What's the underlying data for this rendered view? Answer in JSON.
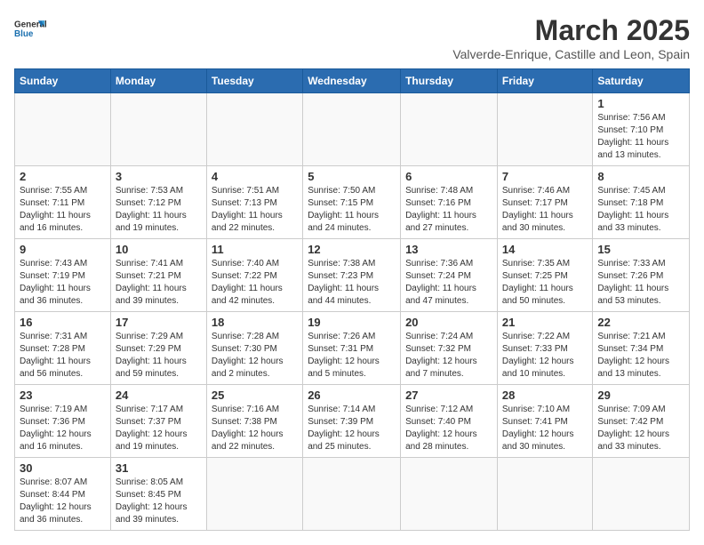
{
  "logo": {
    "text_general": "General",
    "text_blue": "Blue"
  },
  "title": "March 2025",
  "subtitle": "Valverde-Enrique, Castille and Leon, Spain",
  "days_of_week": [
    "Sunday",
    "Monday",
    "Tuesday",
    "Wednesday",
    "Thursday",
    "Friday",
    "Saturday"
  ],
  "weeks": [
    [
      {
        "day": "",
        "info": ""
      },
      {
        "day": "",
        "info": ""
      },
      {
        "day": "",
        "info": ""
      },
      {
        "day": "",
        "info": ""
      },
      {
        "day": "",
        "info": ""
      },
      {
        "day": "",
        "info": ""
      },
      {
        "day": "1",
        "info": "Sunrise: 7:56 AM\nSunset: 7:10 PM\nDaylight: 11 hours and 13 minutes."
      }
    ],
    [
      {
        "day": "2",
        "info": "Sunrise: 7:55 AM\nSunset: 7:11 PM\nDaylight: 11 hours and 16 minutes."
      },
      {
        "day": "3",
        "info": "Sunrise: 7:53 AM\nSunset: 7:12 PM\nDaylight: 11 hours and 19 minutes."
      },
      {
        "day": "4",
        "info": "Sunrise: 7:51 AM\nSunset: 7:13 PM\nDaylight: 11 hours and 22 minutes."
      },
      {
        "day": "5",
        "info": "Sunrise: 7:50 AM\nSunset: 7:15 PM\nDaylight: 11 hours and 24 minutes."
      },
      {
        "day": "6",
        "info": "Sunrise: 7:48 AM\nSunset: 7:16 PM\nDaylight: 11 hours and 27 minutes."
      },
      {
        "day": "7",
        "info": "Sunrise: 7:46 AM\nSunset: 7:17 PM\nDaylight: 11 hours and 30 minutes."
      },
      {
        "day": "8",
        "info": "Sunrise: 7:45 AM\nSunset: 7:18 PM\nDaylight: 11 hours and 33 minutes."
      }
    ],
    [
      {
        "day": "9",
        "info": "Sunrise: 7:43 AM\nSunset: 7:19 PM\nDaylight: 11 hours and 36 minutes."
      },
      {
        "day": "10",
        "info": "Sunrise: 7:41 AM\nSunset: 7:21 PM\nDaylight: 11 hours and 39 minutes."
      },
      {
        "day": "11",
        "info": "Sunrise: 7:40 AM\nSunset: 7:22 PM\nDaylight: 11 hours and 42 minutes."
      },
      {
        "day": "12",
        "info": "Sunrise: 7:38 AM\nSunset: 7:23 PM\nDaylight: 11 hours and 44 minutes."
      },
      {
        "day": "13",
        "info": "Sunrise: 7:36 AM\nSunset: 7:24 PM\nDaylight: 11 hours and 47 minutes."
      },
      {
        "day": "14",
        "info": "Sunrise: 7:35 AM\nSunset: 7:25 PM\nDaylight: 11 hours and 50 minutes."
      },
      {
        "day": "15",
        "info": "Sunrise: 7:33 AM\nSunset: 7:26 PM\nDaylight: 11 hours and 53 minutes."
      }
    ],
    [
      {
        "day": "16",
        "info": "Sunrise: 7:31 AM\nSunset: 7:28 PM\nDaylight: 11 hours and 56 minutes."
      },
      {
        "day": "17",
        "info": "Sunrise: 7:29 AM\nSunset: 7:29 PM\nDaylight: 11 hours and 59 minutes."
      },
      {
        "day": "18",
        "info": "Sunrise: 7:28 AM\nSunset: 7:30 PM\nDaylight: 12 hours and 2 minutes."
      },
      {
        "day": "19",
        "info": "Sunrise: 7:26 AM\nSunset: 7:31 PM\nDaylight: 12 hours and 5 minutes."
      },
      {
        "day": "20",
        "info": "Sunrise: 7:24 AM\nSunset: 7:32 PM\nDaylight: 12 hours and 7 minutes."
      },
      {
        "day": "21",
        "info": "Sunrise: 7:22 AM\nSunset: 7:33 PM\nDaylight: 12 hours and 10 minutes."
      },
      {
        "day": "22",
        "info": "Sunrise: 7:21 AM\nSunset: 7:34 PM\nDaylight: 12 hours and 13 minutes."
      }
    ],
    [
      {
        "day": "23",
        "info": "Sunrise: 7:19 AM\nSunset: 7:36 PM\nDaylight: 12 hours and 16 minutes."
      },
      {
        "day": "24",
        "info": "Sunrise: 7:17 AM\nSunset: 7:37 PM\nDaylight: 12 hours and 19 minutes."
      },
      {
        "day": "25",
        "info": "Sunrise: 7:16 AM\nSunset: 7:38 PM\nDaylight: 12 hours and 22 minutes."
      },
      {
        "day": "26",
        "info": "Sunrise: 7:14 AM\nSunset: 7:39 PM\nDaylight: 12 hours and 25 minutes."
      },
      {
        "day": "27",
        "info": "Sunrise: 7:12 AM\nSunset: 7:40 PM\nDaylight: 12 hours and 28 minutes."
      },
      {
        "day": "28",
        "info": "Sunrise: 7:10 AM\nSunset: 7:41 PM\nDaylight: 12 hours and 30 minutes."
      },
      {
        "day": "29",
        "info": "Sunrise: 7:09 AM\nSunset: 7:42 PM\nDaylight: 12 hours and 33 minutes."
      }
    ],
    [
      {
        "day": "30",
        "info": "Sunrise: 8:07 AM\nSunset: 8:44 PM\nDaylight: 12 hours and 36 minutes."
      },
      {
        "day": "31",
        "info": "Sunrise: 8:05 AM\nSunset: 8:45 PM\nDaylight: 12 hours and 39 minutes."
      },
      {
        "day": "",
        "info": ""
      },
      {
        "day": "",
        "info": ""
      },
      {
        "day": "",
        "info": ""
      },
      {
        "day": "",
        "info": ""
      },
      {
        "day": "",
        "info": ""
      }
    ]
  ]
}
